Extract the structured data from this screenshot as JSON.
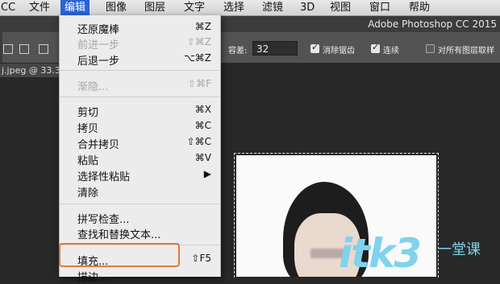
{
  "menubar": {
    "items": [
      "CC",
      "文件",
      "编辑",
      "图像",
      "图层",
      "文字",
      "选择",
      "滤镜",
      "3D",
      "视图",
      "窗口",
      "帮助"
    ],
    "active_index": 2
  },
  "window": {
    "title": "Adobe Photoshop CC 2015"
  },
  "options": {
    "tolerance_label": "容差:",
    "tolerance_value": "32",
    "antialias_label": "消除锯齿",
    "contiguous_label": "连续",
    "sample_all_label": "对所有图层取样"
  },
  "document_tab": {
    "label": "j.jpeg @ 33.3"
  },
  "edit_menu": {
    "items": [
      {
        "label": "还原魔棒",
        "shortcut": "⌘Z",
        "disabled": false
      },
      {
        "label": "前进一步",
        "shortcut": "⇧⌘Z",
        "disabled": true
      },
      {
        "label": "后退一步",
        "shortcut": "⌥⌘Z",
        "disabled": false
      },
      {
        "label": "渐隐...",
        "shortcut": "⇧⌘F",
        "disabled": true
      },
      {
        "label": "剪切",
        "shortcut": "⌘X",
        "disabled": false
      },
      {
        "label": "拷贝",
        "shortcut": "⌘C",
        "disabled": false
      },
      {
        "label": "合并拷贝",
        "shortcut": "⇧⌘C",
        "disabled": false
      },
      {
        "label": "粘贴",
        "shortcut": "⌘V",
        "disabled": false
      },
      {
        "label": "选择性粘贴",
        "shortcut": "▶",
        "disabled": false
      },
      {
        "label": "清除",
        "shortcut": "",
        "disabled": false
      },
      {
        "label": "拼写检查...",
        "shortcut": "",
        "disabled": false
      },
      {
        "label": "查找和替换文本...",
        "shortcut": "",
        "disabled": false
      },
      {
        "label": "填充...",
        "shortcut": "⇧F5",
        "disabled": false
      },
      {
        "label": "描边...",
        "shortcut": "",
        "disabled": false
      }
    ]
  },
  "watermark": {
    "text": "itk3",
    "sub": "一堂课",
    "color": "#7fd3ec"
  },
  "colors": {
    "highlight": "#e07a40",
    "menu_active": "#2a64d6"
  }
}
